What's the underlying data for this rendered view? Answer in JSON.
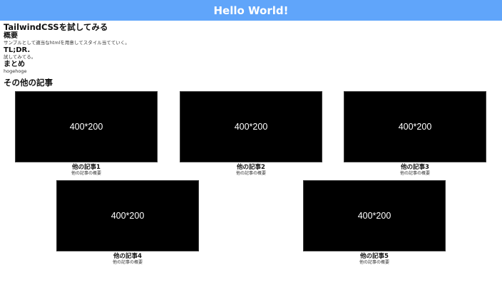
{
  "header": {
    "title": "Hello World!",
    "bg_color": "#60a5fa"
  },
  "article": {
    "title": "TailwindCSSを試してみる",
    "sections": [
      {
        "heading": "概要",
        "text": "サンプルとして適当なhtmlを用意してスタイル当てていく。"
      },
      {
        "heading": "TL;DR.",
        "text": "試してみてる。"
      },
      {
        "heading": "まとめ",
        "text": "hogehoge"
      }
    ]
  },
  "others": {
    "title": "その他の記事",
    "cards": [
      {
        "image_label": "400*200",
        "title": "他の記事1",
        "desc": "他の記事の概要"
      },
      {
        "image_label": "400*200",
        "title": "他の記事2",
        "desc": "他の記事の概要"
      },
      {
        "image_label": "400*200",
        "title": "他の記事3",
        "desc": "他の記事の概要"
      },
      {
        "image_label": "400*200",
        "title": "他の記事4",
        "desc": "他の記事の概要"
      },
      {
        "image_label": "400*200",
        "title": "他の記事5",
        "desc": "他の記事の概要"
      }
    ]
  }
}
